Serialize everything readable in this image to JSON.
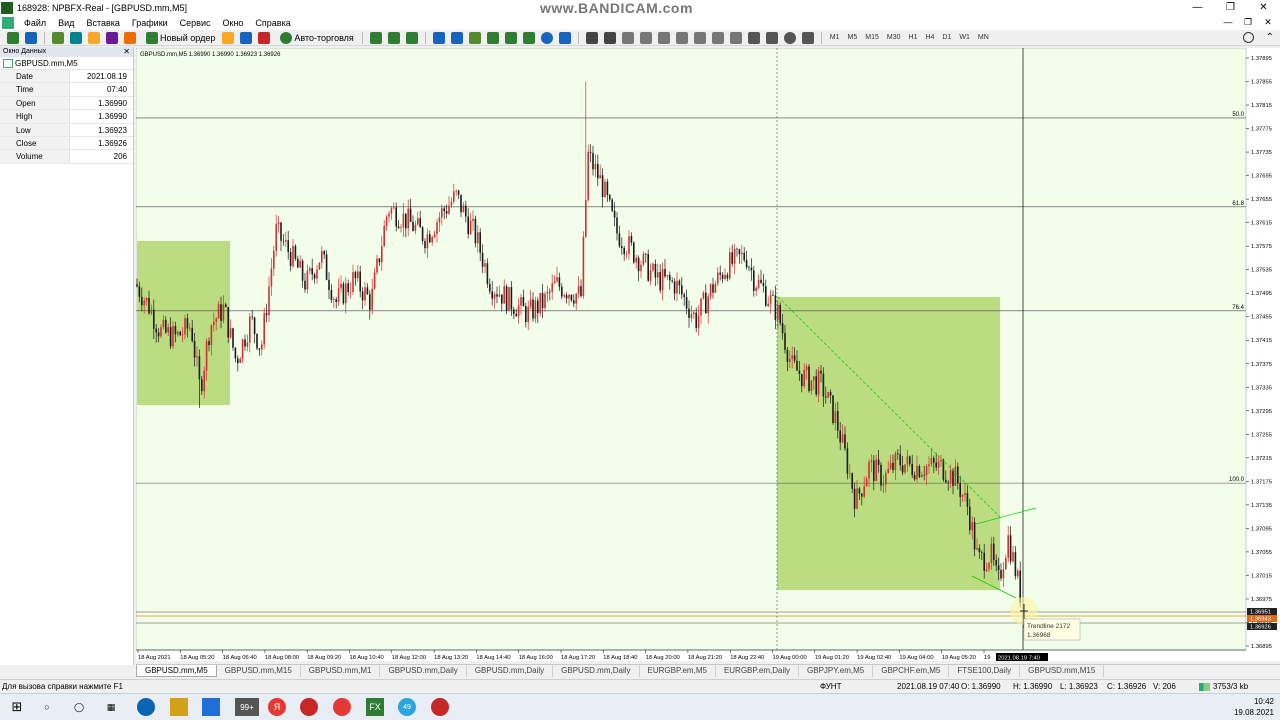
{
  "window": {
    "title": "168928: NPBFX-Real - [GBPUSD.mm,M5]",
    "watermark": "www.BANDICAM.com",
    "controls": [
      "—",
      "❐",
      "✕"
    ]
  },
  "menu": {
    "items": [
      "Файл",
      "Вид",
      "Вставка",
      "Графики",
      "Сервис",
      "Окно",
      "Справка"
    ],
    "mdi_controls": [
      "—",
      "❐",
      "✕"
    ]
  },
  "toolbar": {
    "new_order": "Новый ордер",
    "auto_trading": "Авто-торговля",
    "timeframes": [
      "M1",
      "M5",
      "M15",
      "M30",
      "H1",
      "H4",
      "D1",
      "W1",
      "MN"
    ],
    "icon_colors": [
      "#2e7d32",
      "#1565c0",
      "#558b2f",
      "#c62828",
      "#f9a825",
      "#6a1b9a",
      "#00838f",
      "#ef6c00"
    ]
  },
  "data_window": {
    "header": "Окно Данных",
    "close": "✕",
    "symbol": "GBPUSD.mm,M5",
    "rows": [
      {
        "label": "Date",
        "value": "2021.08.19"
      },
      {
        "label": "Time",
        "value": "07:40"
      },
      {
        "label": "Open",
        "value": "1.36990"
      },
      {
        "label": "High",
        "value": "1.36990"
      },
      {
        "label": "Low",
        "value": "1.36923"
      },
      {
        "label": "Close",
        "value": "1.36926"
      },
      {
        "label": "Volume",
        "value": "206"
      }
    ]
  },
  "chart": {
    "header": "GBPUSD.mm,M5  1.36990 1.36990 1.36923 1.36926",
    "bg_color": "#f3feea",
    "box_color": "#bcdc82",
    "bull_color": "#d32f2f",
    "bear_color": "#1a1a1a",
    "trend_color": "#00cc00",
    "price_levels": [
      "1.37895",
      "1.37855",
      "1.37815",
      "1.37775",
      "1.37735",
      "1.37695",
      "1.37655",
      "1.37615",
      "1.37575",
      "1.37535",
      "1.37495",
      "1.37455",
      "1.37415",
      "1.37375",
      "1.37335",
      "1.37295",
      "1.37255",
      "1.37215",
      "1.37175",
      "1.37135",
      "1.37095",
      "1.37055",
      "1.37015",
      "1.36975",
      "1.36935",
      "1.36895"
    ],
    "fib_levels": [
      {
        "label": "50.0",
        "price": 1.37793
      },
      {
        "label": "61.8",
        "price": 1.37642
      },
      {
        "label": "76.4",
        "price": 1.37465
      },
      {
        "label": "100.0",
        "price": 1.37172
      }
    ],
    "price_tags": [
      "1.36951",
      "1.36943",
      "1.36926"
    ],
    "time_labels": [
      "18 Aug 2021",
      "18 Aug 05:20",
      "18 Aug 06:40",
      "18 Aug 08:00",
      "18 Aug 09:20",
      "18 Aug 10:40",
      "18 Aug 12:00",
      "18 Aug 13:20",
      "18 Aug 14:40",
      "18 Aug 16:00",
      "18 Aug 17:20",
      "18 Aug 18:40",
      "18 Aug 20:00",
      "18 Aug 21:20",
      "18 Aug 22:40",
      "19 Aug 00:00",
      "19 Aug 01:20",
      "19 Aug 02:40",
      "19 Aug 04:00",
      "19 Aug 05:20",
      "19"
    ],
    "time_cursor": "2021.08.19 7:40",
    "tooltip": {
      "line1": "Trendline 2172",
      "line2": "1.36968"
    }
  },
  "tabs": [
    "GBPUSD.mm,M5",
    "GBPUSD.mm,M15",
    "GBPUSD.mm,M1",
    "GBPUSD.mm,Daily",
    "GBPUSD.mm,Daily",
    "GBPUSD.mm,Daily",
    "EURGBP.em,M5",
    "EURGBP.em,Daily",
    "GBPJPY.em,M5",
    "GBPCHF.em,M5",
    "FTSE100,Daily",
    "GBPUSD.mm,M15"
  ],
  "status": {
    "help": "Для вызова справки нажмите F1",
    "profile": "ФУНТ",
    "datetime": "2021.08.19 07:40",
    "open": "O: 1.36990",
    "high": "H: 1.36990",
    "low": "L: 1.36923",
    "close": "C: 1.36926",
    "volume": "V: 206",
    "traffic": "3753/3 kb"
  },
  "taskbar": {
    "badge": "99+",
    "badge2": "49",
    "time": "10:42",
    "date": "19.08.2021",
    "icon_colors": [
      "#0a64b4",
      "#d4a017",
      "#1e6fd9",
      "#e53935",
      "#c62828",
      "#e53935",
      "#2e7d32",
      "#2ca5e0",
      "#c62828"
    ]
  }
}
